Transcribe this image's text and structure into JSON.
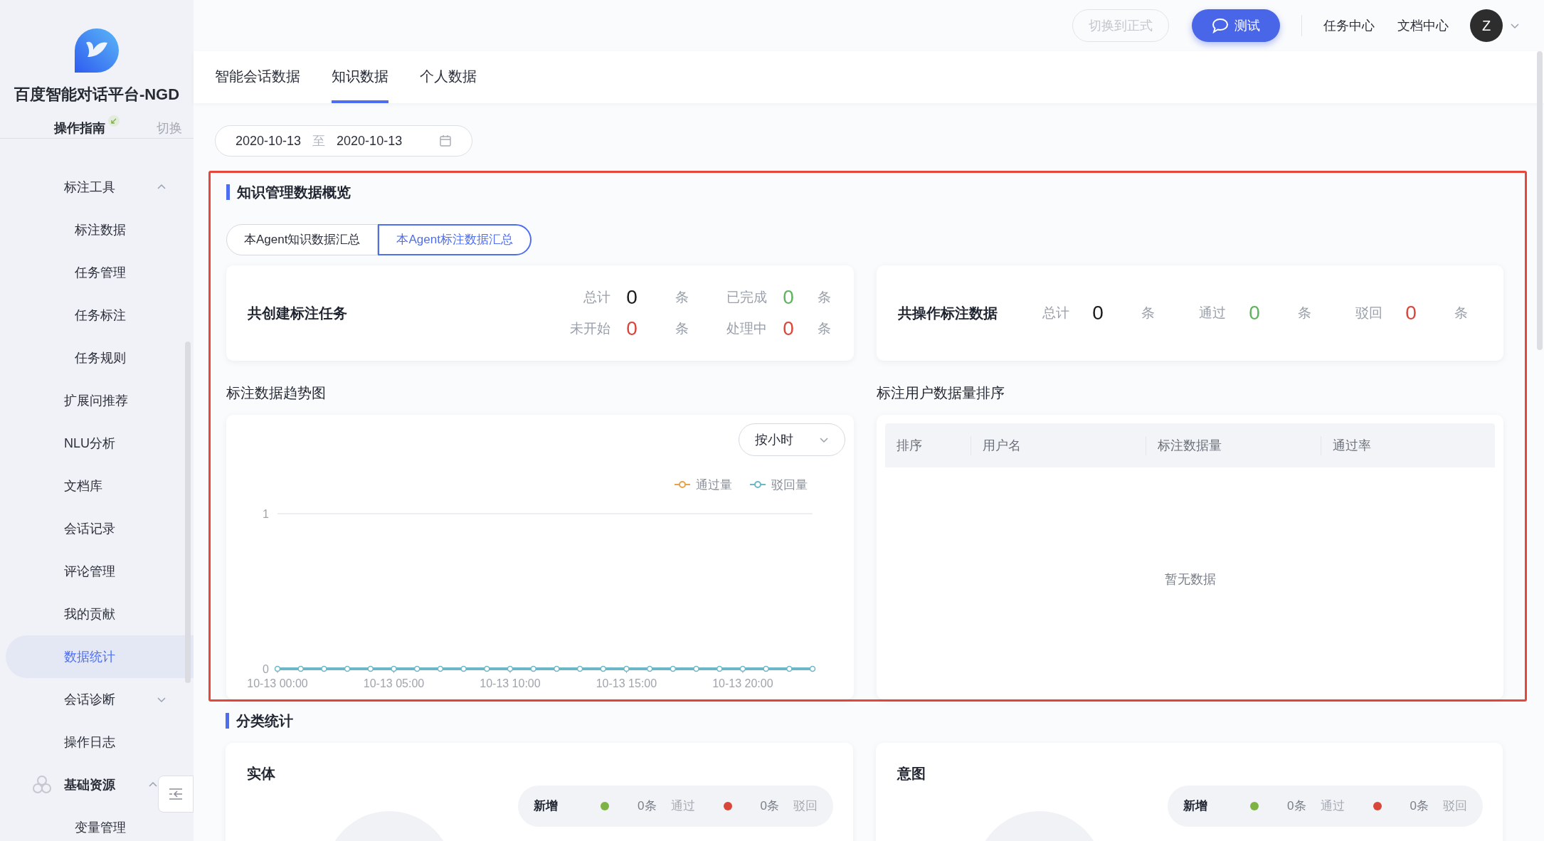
{
  "sidebar": {
    "title": "百度智能对话平台-NGD",
    "guide": "操作指南",
    "switch": "切换",
    "items": [
      {
        "kind": "item",
        "label": "标注工具",
        "selected": false,
        "expanded": true,
        "children": [
          {
            "kind": "item",
            "label": "标注数据",
            "selected": false
          },
          {
            "kind": "item",
            "label": "任务管理",
            "selected": false
          },
          {
            "kind": "item",
            "label": "任务标注",
            "selected": false
          },
          {
            "kind": "item",
            "label": "任务规则",
            "selected": false
          }
        ]
      },
      {
        "kind": "item",
        "label": "扩展问推荐",
        "selected": false
      },
      {
        "kind": "item",
        "label": "NLU分析",
        "selected": false
      },
      {
        "kind": "item",
        "label": "文档库",
        "selected": false
      },
      {
        "kind": "item",
        "label": "会话记录",
        "selected": false
      },
      {
        "kind": "item",
        "label": "评论管理",
        "selected": false
      },
      {
        "kind": "item",
        "label": "我的贡献",
        "selected": false
      },
      {
        "kind": "item",
        "label": "数据统计",
        "selected": true
      },
      {
        "kind": "item",
        "label": "会话诊断",
        "selected": false,
        "expanded": false
      },
      {
        "kind": "item",
        "label": "操作日志",
        "selected": false
      },
      {
        "kind": "group",
        "label": "基础资源",
        "selected": false,
        "expanded": true,
        "children": [
          {
            "kind": "item",
            "label": "变量管理",
            "selected": false
          }
        ]
      }
    ]
  },
  "top_bar": {
    "switch_button": {
      "label": "切换到正式",
      "disabled": true
    },
    "test_button": "测试",
    "links": [
      "任务中心",
      "文档中心"
    ],
    "avatar": "Z"
  },
  "tabs": [
    {
      "label": "智能会话数据",
      "selected": false
    },
    {
      "label": "知识数据",
      "selected": true
    },
    {
      "label": "个人数据",
      "selected": false
    }
  ],
  "date_range": {
    "start": "2020-10-13",
    "separator": "至",
    "end": "2020-10-13"
  },
  "overview": {
    "title": "知识管理数据概览",
    "sub_tabs": [
      {
        "label": "本Agent知识数据汇总",
        "selected": false
      },
      {
        "label": "本Agent标注数据汇总",
        "selected": true
      }
    ],
    "task_card": {
      "title": "共创建标注任务",
      "stats": [
        {
          "label": "总计",
          "value": "0",
          "unit": "条",
          "color": "#1a1a1a"
        },
        {
          "label": "已完成",
          "value": "0",
          "unit": "条",
          "color": "#5fb35f"
        },
        {
          "label": "未开始",
          "value": "0",
          "unit": "条",
          "color": "#d9463b"
        },
        {
          "label": "处理中",
          "value": "0",
          "unit": "条",
          "color": "#d9463b"
        }
      ]
    },
    "data_card": {
      "title": "共操作标注数据",
      "stats": [
        {
          "label": "总计",
          "value": "0",
          "unit": "条",
          "color": "#1a1a1a"
        },
        {
          "label": "通过",
          "value": "0",
          "unit": "条",
          "color": "#5fb35f"
        },
        {
          "label": "驳回",
          "value": "0",
          "unit": "条",
          "color": "#d9463b"
        }
      ]
    },
    "trend": {
      "title": "标注数据趋势图",
      "granularity": "按小时",
      "chart_data": {
        "type": "line",
        "categories": [
          "10-13 00:00",
          null,
          null,
          null,
          null,
          "10-13 05:00",
          null,
          null,
          null,
          null,
          "10-13 10:00",
          null,
          null,
          null,
          null,
          "10-13 15:00",
          null,
          null,
          null,
          null,
          "10-13 20:00",
          null,
          null,
          null
        ],
        "legend": "top-right",
        "ylim": [
          0,
          1
        ],
        "yticks": [
          0,
          1
        ],
        "series": [
          {
            "name": "通过量",
            "color": "#e8a24b",
            "marker": "circle",
            "values": [
              null,
              null,
              null,
              null,
              null,
              null,
              null,
              null,
              null,
              null,
              null,
              null,
              null,
              null,
              null,
              null,
              null,
              null,
              null,
              null,
              null,
              null,
              null,
              null
            ]
          },
          {
            "name": "驳回量",
            "color": "#6bb7c7",
            "marker": "circle",
            "values": [
              0,
              0,
              0,
              0,
              0,
              0,
              0,
              0,
              0,
              0,
              0,
              0,
              0,
              0,
              0,
              0,
              0,
              0,
              0,
              0,
              0,
              0,
              0,
              0
            ]
          }
        ]
      }
    },
    "ranking": {
      "title": "标注用户数据量排序",
      "columns": [
        "排序",
        "用户名",
        "标注数据量",
        "通过率"
      ],
      "empty": "暂无数据"
    }
  },
  "category": {
    "title": "分类统计",
    "cards": [
      {
        "title": "实体",
        "stats": [
          {
            "label": "新增"
          },
          {
            "value": "0条",
            "label": "通过",
            "color": "#7cb342"
          },
          {
            "value": "0条",
            "label": "驳回",
            "color": "#d9463b"
          }
        ]
      },
      {
        "title": "意图",
        "stats": [
          {
            "label": "新增"
          },
          {
            "value": "0条",
            "label": "通过",
            "color": "#7cb342"
          },
          {
            "value": "0条",
            "label": "驳回",
            "color": "#d9463b"
          }
        ]
      }
    ]
  }
}
